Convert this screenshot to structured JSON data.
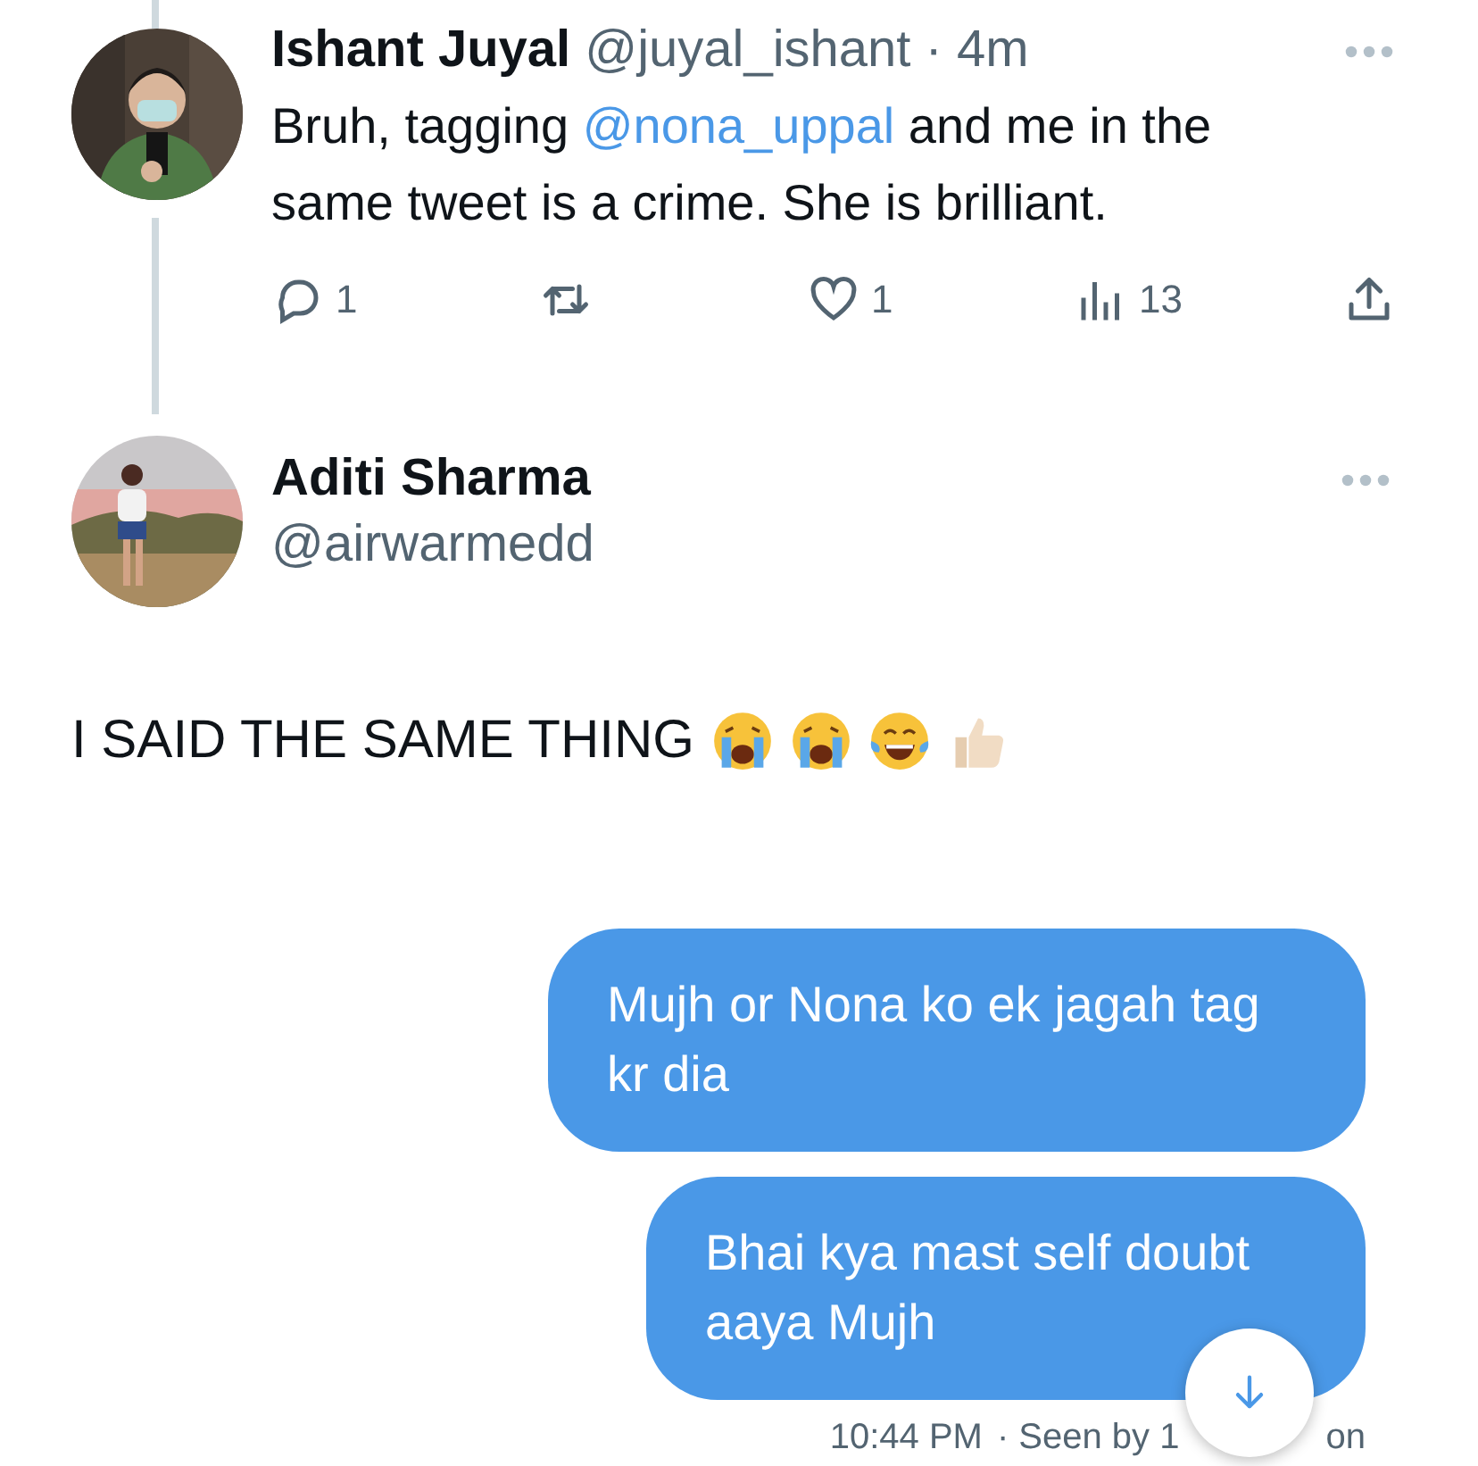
{
  "quoted_tweet": {
    "name": "Ishant Juyal",
    "handle": "@juyal_ishant",
    "time": "· 4m",
    "text_before": "Bruh, tagging ",
    "mention": "@nona_uppal",
    "text_after": " and me in the same tweet is a crime. She is brilliant.",
    "actions": [
      {
        "kind": "reply",
        "count": "1"
      },
      {
        "kind": "retweet"
      },
      {
        "kind": "like",
        "count": "1"
      },
      {
        "kind": "views",
        "count": "13"
      },
      {
        "kind": "share"
      }
    ]
  },
  "reply_tweet": {
    "name": "Aditi Sharma",
    "handle": "@airwarmedd",
    "text": "I SAID THE SAME THING",
    "emoji": [
      {
        "kind": "crying"
      },
      {
        "kind": "crying"
      },
      {
        "kind": "laughing"
      },
      {
        "kind": "thumbs"
      }
    ]
  },
  "messages": [
    {
      "text": "Mujh or Nona ko ek jagah tag kr dia"
    },
    {
      "text": "Bhai kya mast self doubt aaya Mujh"
    }
  ],
  "status": {
    "time": "10:44 PM",
    "seen": "· Seen by 1",
    "seen_tail": "on"
  }
}
